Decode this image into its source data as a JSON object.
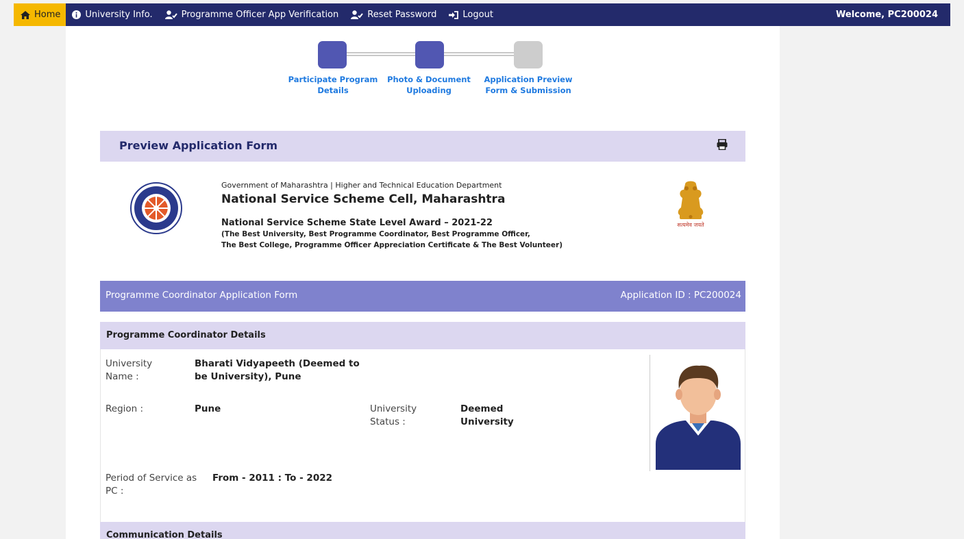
{
  "nav": {
    "home": "Home",
    "university_info": "University Info.",
    "po_verification": "Programme Officer App Verification",
    "reset_password": "Reset Password",
    "logout": "Logout",
    "welcome": "Welcome, PC200024"
  },
  "stepper": {
    "steps": [
      {
        "line1": "Participate Program",
        "line2": "Details",
        "state": "done"
      },
      {
        "line1": "Photo & Document",
        "line2": "Uploading",
        "state": "done"
      },
      {
        "line1": "Application Preview",
        "line2": "Form & Submission",
        "state": "todo"
      }
    ]
  },
  "preview": {
    "title": "Preview Application Form",
    "print_icon": "print-icon"
  },
  "letterhead": {
    "dept": "Government of Maharashtra | Higher and Technical Education Department",
    "cell": "National Service Scheme Cell, Maharashtra",
    "award": "National Service Scheme State Level Award – 2021-22",
    "categories_line1": "(The Best University, Best Programme Coordinator, Best Programme Officer,",
    "categories_line2": "The Best College, Programme Officer Appreciation Certificate & The Best Volunteer)",
    "emblem_text": "सत्यमेव जयते"
  },
  "form": {
    "title": "Programme Coordinator Application Form",
    "application_id": "Application ID : PC200024"
  },
  "details": {
    "heading": "Programme Coordinator Details",
    "university_label_1": "University",
    "university_label_2": "Name :",
    "university_value_1": "Bharati Vidyapeeth (Deemed to",
    "university_value_2": "be University), Pune",
    "region_label": "Region :",
    "region_value": "Pune",
    "status_label_1": "University",
    "status_label_2": "Status :",
    "status_value_1": "Deemed",
    "status_value_2": "University",
    "period_label_1": "Period of Service as",
    "period_label_2": "PC :",
    "period_value": "From - 2011 : To - 2022"
  },
  "communication": {
    "heading": "Communication Details"
  },
  "colors": {
    "nav_bg": "#232a6b",
    "home_bg": "#f5b800",
    "step_done": "#5157b2",
    "step_todo": "#cdcdcd",
    "section_bg": "#dcd7f0",
    "form_head_bg": "#7f82cd",
    "link_blue": "#1f7ae0"
  }
}
